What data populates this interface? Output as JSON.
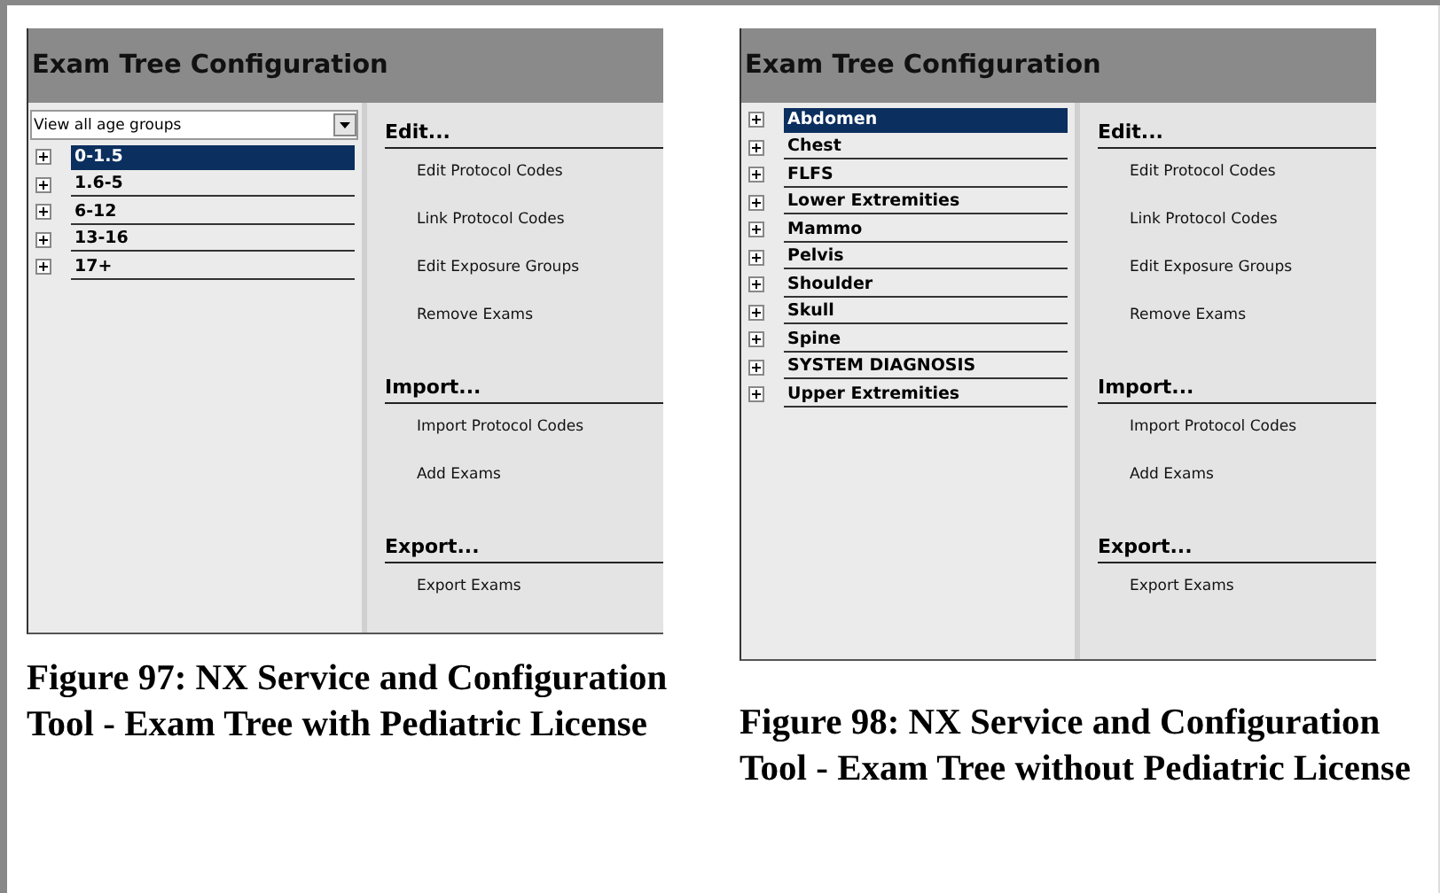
{
  "figures": [
    {
      "window": {
        "title": "Exam Tree Configuration"
      },
      "dropdown": {
        "value": "View all age groups"
      },
      "tree": [
        {
          "label": "0-1.5",
          "selected": true
        },
        {
          "label": "1.6-5",
          "selected": false
        },
        {
          "label": "6-12",
          "selected": false
        },
        {
          "label": "13-16",
          "selected": false
        },
        {
          "label": "17+",
          "selected": false
        }
      ],
      "sections": [
        {
          "title": "Edit...",
          "actions": [
            "Edit Protocol Codes",
            "Link Protocol Codes",
            "Edit Exposure Groups",
            "Remove Exams"
          ]
        },
        {
          "title": "Import...",
          "actions": [
            "Import Protocol Codes",
            "Add Exams"
          ]
        },
        {
          "title": "Export...",
          "actions": [
            "Export Exams"
          ]
        }
      ],
      "caption": "Figure 97: NX Service and Configuration Tool - Exam Tree with Pediatric License"
    },
    {
      "window": {
        "title": "Exam Tree Configuration"
      },
      "tree": [
        {
          "label": "Abdomen",
          "selected": true
        },
        {
          "label": "Chest",
          "selected": false
        },
        {
          "label": "FLFS",
          "selected": false
        },
        {
          "label": "Lower Extremities",
          "selected": false
        },
        {
          "label": "Mammo",
          "selected": false
        },
        {
          "label": "Pelvis",
          "selected": false
        },
        {
          "label": "Shoulder",
          "selected": false
        },
        {
          "label": "Skull",
          "selected": false
        },
        {
          "label": "Spine",
          "selected": false
        },
        {
          "label": "SYSTEM DIAGNOSIS",
          "selected": false
        },
        {
          "label": "Upper Extremities",
          "selected": false
        }
      ],
      "sections": [
        {
          "title": "Edit...",
          "actions": [
            "Edit Protocol Codes",
            "Link Protocol Codes",
            "Edit Exposure Groups",
            "Remove Exams"
          ]
        },
        {
          "title": "Import...",
          "actions": [
            "Import Protocol Codes",
            "Add Exams"
          ]
        },
        {
          "title": "Export...",
          "actions": [
            "Export Exams"
          ]
        }
      ],
      "caption": "Figure 98: NX Service and Configuration Tool - Exam Tree without Pediatric License"
    }
  ]
}
